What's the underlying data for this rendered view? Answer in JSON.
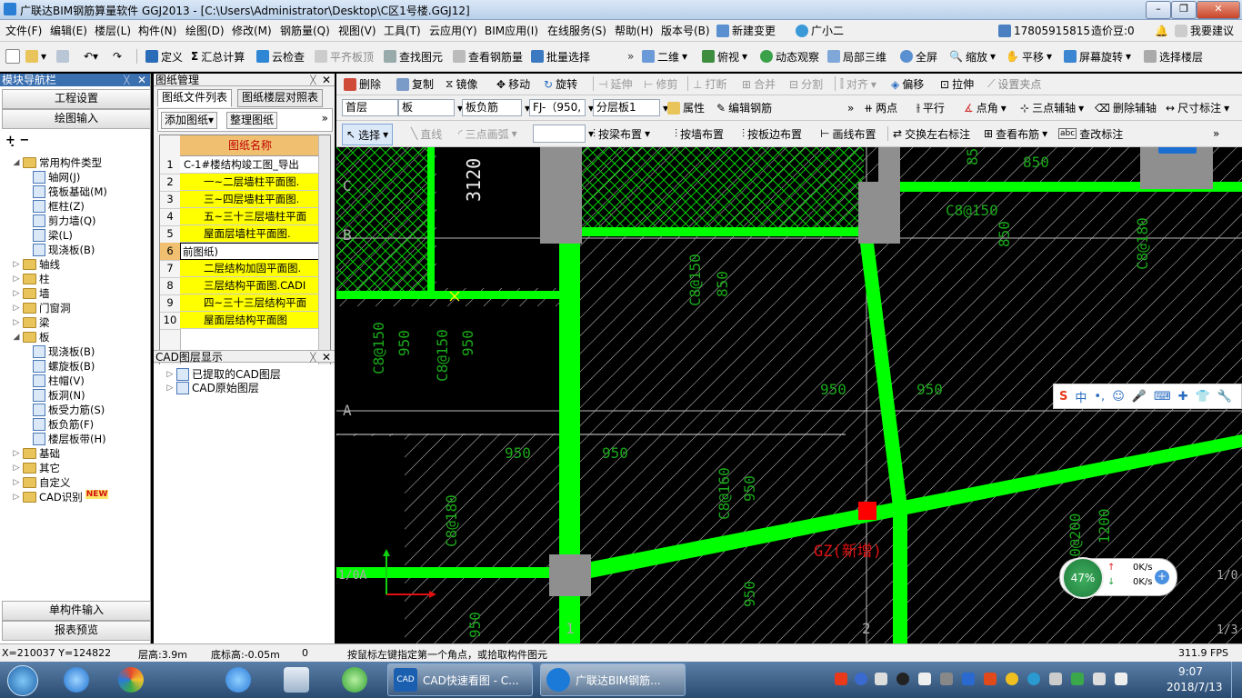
{
  "title": "广联达BIM钢筋算量软件 GGJ2013 - [C:\\Users\\Administrator\\Desktop\\C区1号楼.GGJ12]",
  "menu": [
    "文件(F)",
    "编辑(E)",
    "楼层(L)",
    "构件(N)",
    "绘图(D)",
    "修改(M)",
    "钢筋量(Q)",
    "视图(V)",
    "工具(T)",
    "云应用(Y)",
    "BIM应用(I)",
    "在线服务(S)",
    "帮助(H)",
    "版本号(B)",
    "新建变更",
    "广小二"
  ],
  "menu_right": {
    "phone": "17805915815",
    "cost": "造价豆:0",
    "help": "我要建议"
  },
  "toolbar1": [
    "定义",
    "汇总计算",
    "云检查",
    "平齐板顶",
    "查找图元",
    "查看钢筋量",
    "批量选择",
    "二维",
    "俯视",
    "动态观察",
    "局部三维",
    "全屏",
    "缩放",
    "平移",
    "屏幕旋转",
    "选择楼层"
  ],
  "toolbar2": [
    "删除",
    "复制",
    "镜像",
    "移动",
    "旋转",
    "延伸",
    "修剪",
    "打断",
    "合并",
    "分割",
    "对齐",
    "偏移",
    "拉伸",
    "设置夹点"
  ],
  "toolbar3": {
    "floor": "首层",
    "type": "板",
    "sub": "板负筋",
    "comp": "FJ-（950,",
    "layer": "分层板1",
    "attr": "属性",
    "edit": "编辑钢筋",
    "right": [
      "两点",
      "平行",
      "点角",
      "三点辅轴",
      "删除辅轴",
      "尺寸标注"
    ]
  },
  "toolbar4": [
    "选择",
    "直线",
    "三点画弧",
    "按梁布置",
    "按墙布置",
    "按板边布置",
    "画线布置",
    "交换左右标注",
    "查看布筋",
    "查改标注"
  ],
  "leftnav": {
    "header": "模块导航栏",
    "top_buttons": [
      "工程设置",
      "绘图输入"
    ],
    "tree": [
      {
        "label": "常用构件类型",
        "level": 0,
        "expanded": true
      },
      {
        "label": "轴网(J)",
        "level": 1
      },
      {
        "label": "筏板基础(M)",
        "level": 1
      },
      {
        "label": "框柱(Z)",
        "level": 1
      },
      {
        "label": "剪力墙(Q)",
        "level": 1
      },
      {
        "label": "梁(L)",
        "level": 1
      },
      {
        "label": "现浇板(B)",
        "level": 1
      },
      {
        "label": "轴线",
        "level": 0
      },
      {
        "label": "柱",
        "level": 0
      },
      {
        "label": "墙",
        "level": 0
      },
      {
        "label": "门窗洞",
        "level": 0
      },
      {
        "label": "梁",
        "level": 0
      },
      {
        "label": "板",
        "level": 0,
        "expanded": true
      },
      {
        "label": "现浇板(B)",
        "level": 1
      },
      {
        "label": "螺旋板(B)",
        "level": 1
      },
      {
        "label": "柱帽(V)",
        "level": 1
      },
      {
        "label": "板洞(N)",
        "level": 1
      },
      {
        "label": "板受力筋(S)",
        "level": 1
      },
      {
        "label": "板负筋(F)",
        "level": 1
      },
      {
        "label": "楼层板带(H)",
        "level": 1
      },
      {
        "label": "基础",
        "level": 0
      },
      {
        "label": "其它",
        "level": 0
      },
      {
        "label": "自定义",
        "level": 0
      },
      {
        "label": "CAD识别",
        "level": 0,
        "badge": "NEW"
      }
    ],
    "bottom_buttons": [
      "单构件输入",
      "报表预览"
    ]
  },
  "drawmgr": {
    "header": "图纸管理",
    "tabs": [
      "图纸文件列表",
      "图纸楼层对照表"
    ],
    "buttons": [
      "添加图纸",
      "整理图纸"
    ],
    "col": "图纸名称",
    "rows": [
      {
        "n": "1",
        "name": "C-1#楼结构竣工图_导出"
      },
      {
        "n": "2",
        "name": "一~二层墙柱平面图."
      },
      {
        "n": "3",
        "name": "三~四层墙柱平面图."
      },
      {
        "n": "4",
        "name": "五~三十三层墙柱平面"
      },
      {
        "n": "5",
        "name": "屋面层墙柱平面图."
      },
      {
        "n": "6",
        "name": "前图纸)"
      },
      {
        "n": "7",
        "name": "二层结构加固平面图."
      },
      {
        "n": "8",
        "name": "三层结构平面图.CADI"
      },
      {
        "n": "9",
        "name": "四~三十三层结构平面"
      },
      {
        "n": "10",
        "name": "屋面层结构平面图"
      }
    ],
    "cad_header": "CAD图层显示",
    "cad_items": [
      "已提取的CAD图层",
      "CAD原始图层"
    ]
  },
  "canvas_labels": {
    "dims": [
      "3120",
      "C8@150",
      "C8@150",
      "C8@150",
      "C8@180",
      "C8@150",
      "C8@160",
      "C8@180",
      "C10@200",
      "950",
      "950",
      "850",
      "850",
      "950",
      "950",
      "950",
      "950",
      "950",
      "950",
      "950",
      "1200",
      "GZ(新增)",
      "C",
      "B",
      "A",
      "1",
      "2",
      "1/0A",
      "1/0",
      "1/3",
      "850",
      "850"
    ],
    "ime": "中",
    "speed_pct": "47%",
    "up": "0K/s",
    "down": "0K/s"
  },
  "status": {
    "coords": "X=210037  Y=124822",
    "floor_h": "层高:3.9m",
    "base_h": "底标高:-0.05m",
    "zero": "0",
    "hint": "按鼠标左键指定第一个角点，或拾取构件图元",
    "fps": "311.9 FPS"
  },
  "taskbar": {
    "items": [
      "CAD快速看图 - C...",
      "广联达BIM钢筋..."
    ],
    "time": "9:07",
    "date": "2018/7/13"
  },
  "colors": {
    "steel": "#00ff00",
    "hatch": "#cfcfcf",
    "green_text": "#0fa30f",
    "title_bg": "#c7d9f1"
  }
}
